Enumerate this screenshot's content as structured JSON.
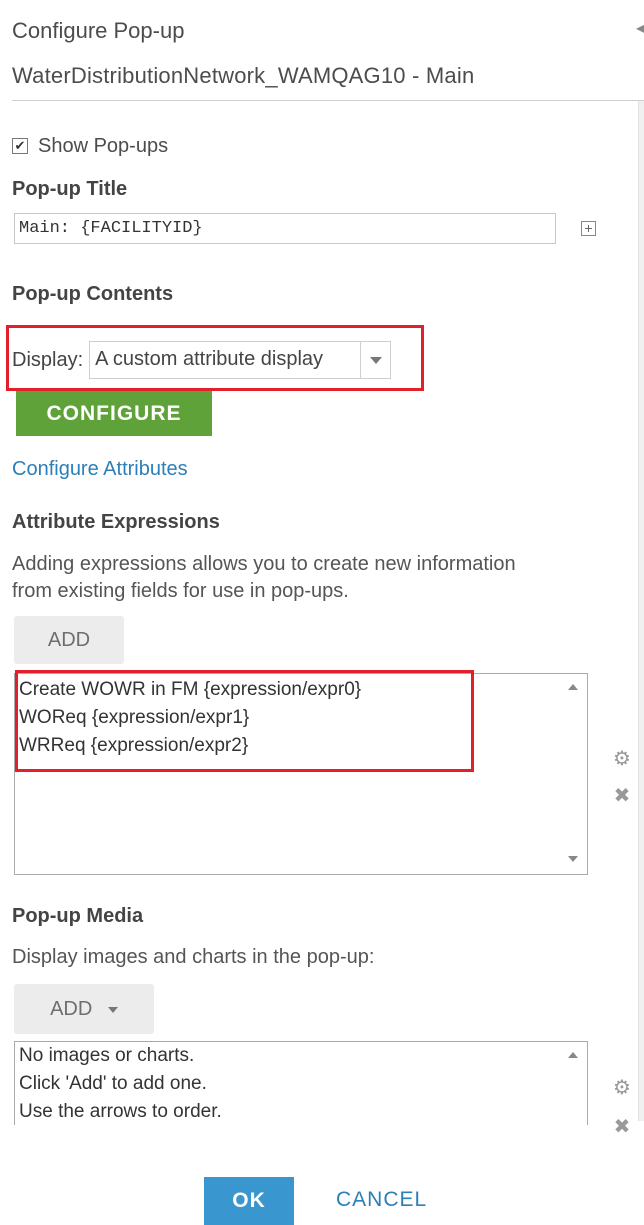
{
  "header": {
    "title": "Configure Pop-up",
    "layer_name": "WaterDistributionNetwork_WAMQAG10 - Main"
  },
  "show_popups": {
    "label": "Show Pop-ups",
    "checked": true
  },
  "popup_title": {
    "label": "Pop-up Title",
    "value": "Main: {FACILITYID}"
  },
  "popup_contents": {
    "label": "Pop-up Contents",
    "display_label": "Display:",
    "display_value": "A custom attribute display",
    "configure_label": "CONFIGURE",
    "configure_attributes_link": "Configure Attributes"
  },
  "attribute_expressions": {
    "label": "Attribute Expressions",
    "description_line1": "Adding expressions allows you to create new information",
    "description_line2": "from existing fields for use in pop-ups.",
    "add_label": "ADD",
    "items": [
      "Create WOWR in FM {expression/expr0}",
      "WOReq {expression/expr1}",
      "WRReq {expression/expr2}"
    ]
  },
  "popup_media": {
    "label": "Pop-up Media",
    "description": "Display images and charts in the pop-up:",
    "add_label": "ADD",
    "empty_lines": [
      "No images or charts.",
      "Click 'Add' to add one.",
      "Use the arrows to order."
    ]
  },
  "footer": {
    "ok_label": "OK",
    "cancel_label": "CANCEL"
  },
  "colors": {
    "accent_blue": "#3a96cf",
    "link_blue": "#2c7fb8",
    "configure_green": "#5ea239",
    "highlight_red": "#e2202c"
  }
}
